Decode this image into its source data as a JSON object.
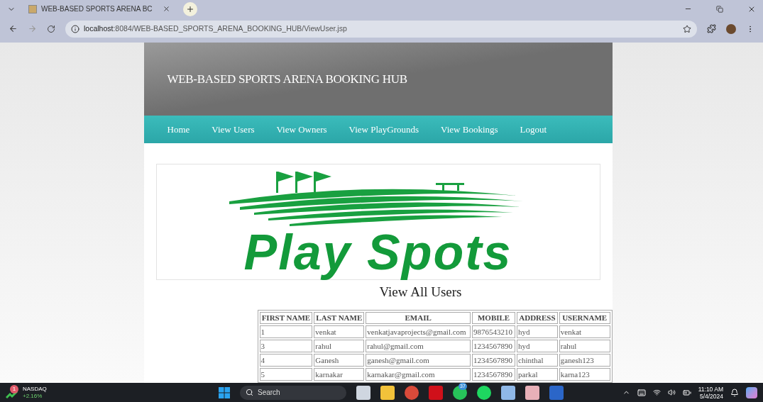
{
  "browser": {
    "tab_title": "WEB-BASED SPORTS ARENA BC",
    "url_host": "localhost",
    "url_path": ":8084/WEB-BASED_SPORTS_ARENA_BOOKING_HUB/ViewUser.jsp"
  },
  "site": {
    "title": "WEB-BASED SPORTS ARENA BOOKING HUB"
  },
  "nav": [
    "Home",
    "View Users",
    "View Owners",
    "View PlayGrounds",
    "View Bookings",
    "Logout"
  ],
  "logo": {
    "text": "Play Spots"
  },
  "heading": "View All Users",
  "table": {
    "columns": [
      "FIRST NAME",
      "LAST NAME",
      "EMAIL",
      "MOBILE",
      "ADDRESS",
      "USERNAME"
    ],
    "rows": [
      [
        "1",
        "venkat",
        "venkatjavaprojects@gmail.com",
        "9876543210",
        "hyd",
        "venkat"
      ],
      [
        "3",
        "rahul",
        "rahul@gmail.com",
        "1234567890",
        "hyd",
        "rahul"
      ],
      [
        "4",
        "Ganesh",
        "ganesh@gmail.com",
        "1234567890",
        "chinthal",
        "ganesh123"
      ],
      [
        "5",
        "karnakar",
        "karnakar@gmail.com",
        "1234567890",
        "parkal",
        "karna123"
      ]
    ]
  },
  "taskbar": {
    "widget_badge": "1",
    "widget_name": "NASDAQ",
    "widget_change": "+2.16%",
    "search_placeholder": "Search",
    "chat_badge": "37",
    "time": "11:10 AM",
    "date": "5/4/2024"
  }
}
